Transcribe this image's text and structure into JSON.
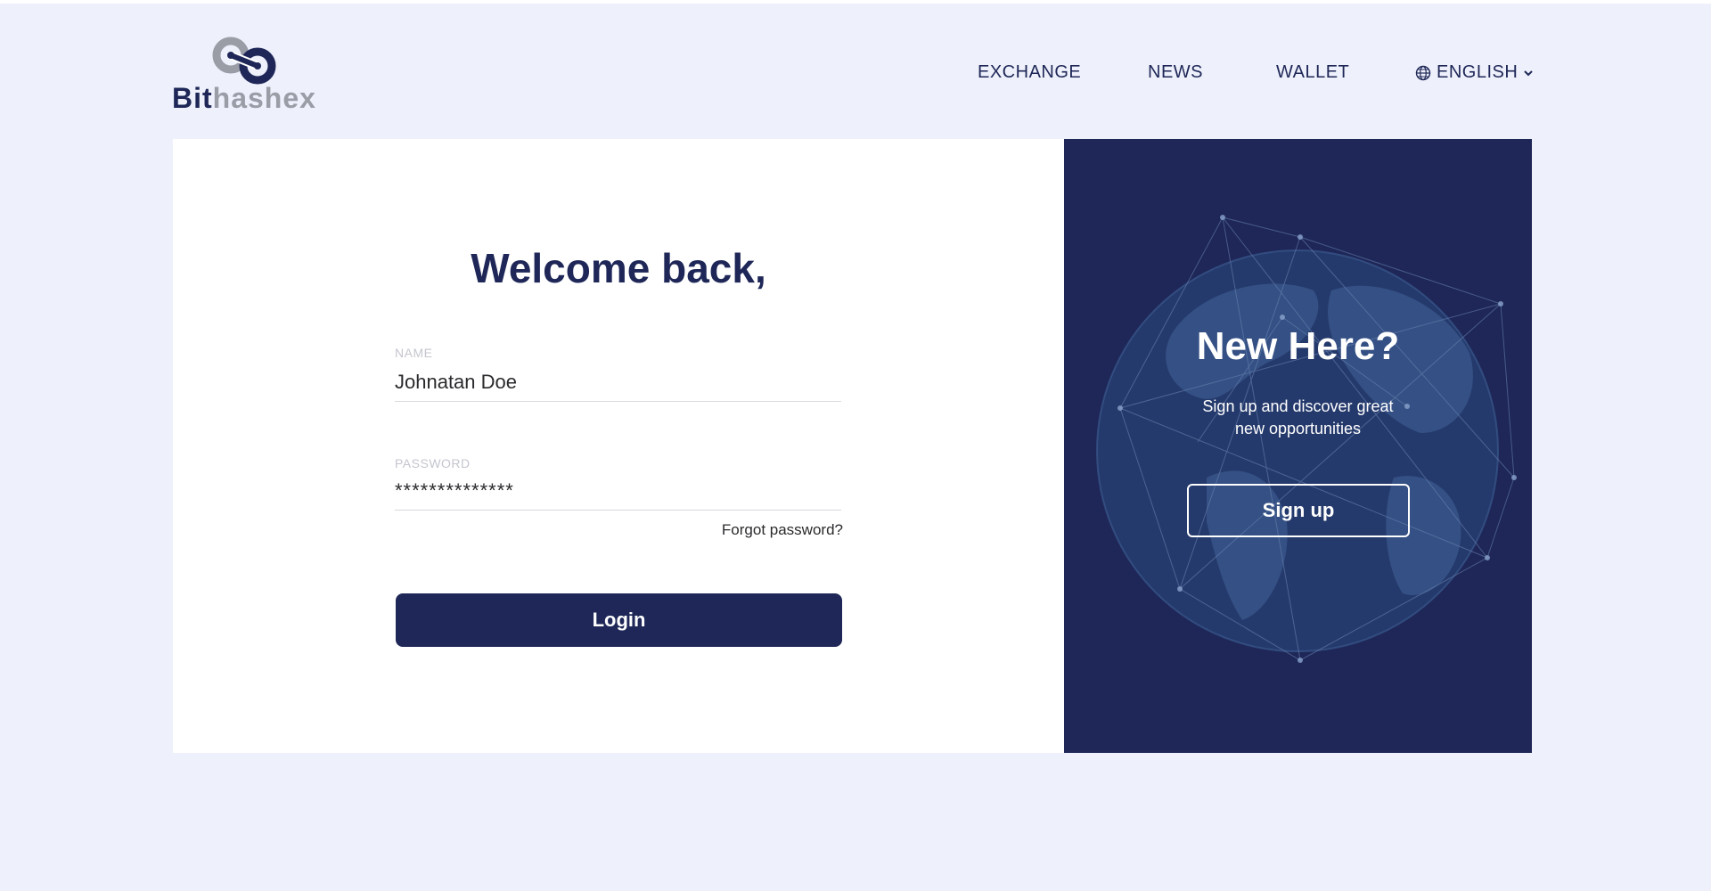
{
  "brand": {
    "name_part1": "Bit",
    "name_part2": "hashex",
    "dark_color": "#1e2757",
    "grey_color": "#9a9ca6",
    "icon": "chain-link-logo-icon"
  },
  "nav": {
    "items": [
      {
        "label": "EXCHANGE"
      },
      {
        "label": "NEWS"
      },
      {
        "label": "WALLET"
      }
    ],
    "language": {
      "label": "ENGLISH",
      "icon": "globe-icon",
      "caret_icon": "chevron-down-icon"
    }
  },
  "login": {
    "title": "Welcome back,",
    "name_label": "NAME",
    "name_value": "Johnatan Doe",
    "password_label": "PASSWORD",
    "password_value": "**************",
    "forgot_label": "Forgot password?",
    "login_button": "Login"
  },
  "signup_panel": {
    "title": "New Here?",
    "subtitle": "Sign up and discover great new opportunities",
    "button": "Sign up",
    "background_color": "#1e2757",
    "background_icon": "world-network-globe-icon"
  },
  "colors": {
    "page_background": "#eef0fb",
    "primary": "#1e2757",
    "card": "#ffffff"
  }
}
